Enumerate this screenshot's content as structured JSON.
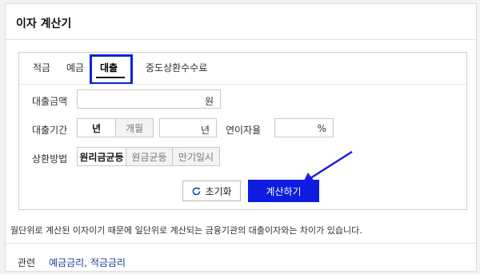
{
  "widget": {
    "title": "이자 계산기"
  },
  "tabs": [
    {
      "label": "적금"
    },
    {
      "label": "예금"
    },
    {
      "label": "대출"
    },
    {
      "label": "중도상환수수료"
    }
  ],
  "active_tab": "대출",
  "form": {
    "loan_amount": {
      "label": "대출금액",
      "value": "",
      "unit": "원"
    },
    "loan_period": {
      "label": "대출기간",
      "units": [
        "년",
        "개월"
      ],
      "selected_unit": "년",
      "value": "",
      "unit": "년"
    },
    "annual_rate": {
      "label": "연이자율",
      "value": "",
      "unit": "%"
    },
    "repayment": {
      "label": "상환방법",
      "options": [
        "원리금균등",
        "원금균등",
        "만기일시"
      ],
      "selected": "원리금균등"
    }
  },
  "buttons": {
    "reset_label": "초기화",
    "calculate_label": "계산하기"
  },
  "note": "월단위로 계산된 이자이기 때문에 일단위로 계산되는 금융기관의 대출이자와는 차이가 있습니다.",
  "related": {
    "label": "관련",
    "links": [
      "예금금리",
      "적금금리"
    ],
    "separator": ", "
  },
  "colors": {
    "highlight_border": "#0a24d8",
    "calc_button_bg": "#0d1ce0",
    "arrow": "#1a1ae6",
    "link": "#1a3f8f"
  }
}
